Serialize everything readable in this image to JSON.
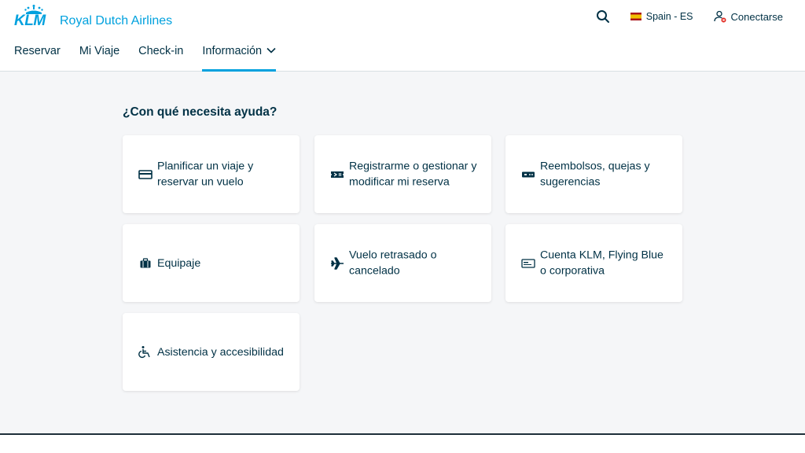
{
  "brand": {
    "wordmark": "KLM",
    "tagline": "Royal Dutch Airlines",
    "color": "#00a1de"
  },
  "nav": {
    "items": [
      {
        "label": "Reservar"
      },
      {
        "label": "Mi Viaje"
      },
      {
        "label": "Check-in"
      },
      {
        "label": "Información",
        "active": true
      }
    ]
  },
  "top": {
    "search_icon": "search-icon",
    "language": "Spain - ES",
    "login": "Conectarse"
  },
  "help": {
    "title": "¿Con qué necesita ayuda?",
    "cards": [
      {
        "label": "Planificar un viaje y reservar un vuelo",
        "icon": "credit-card-icon"
      },
      {
        "label": "Registrarme o gestionar y modificar mi reserva",
        "icon": "ticket-icon"
      },
      {
        "label": "Reembolsos, quejas y sugerencias",
        "icon": "refund-ticket-icon"
      },
      {
        "label": "Equipaje",
        "icon": "suitcase-icon"
      },
      {
        "label": "Vuelo retrasado o cancelado",
        "icon": "plane-icon"
      },
      {
        "label": "Cuenta KLM, Flying Blue o corporativa",
        "icon": "membership-card-icon"
      },
      {
        "label": "Asistencia y accesibilidad",
        "icon": "wheelchair-icon"
      }
    ]
  }
}
